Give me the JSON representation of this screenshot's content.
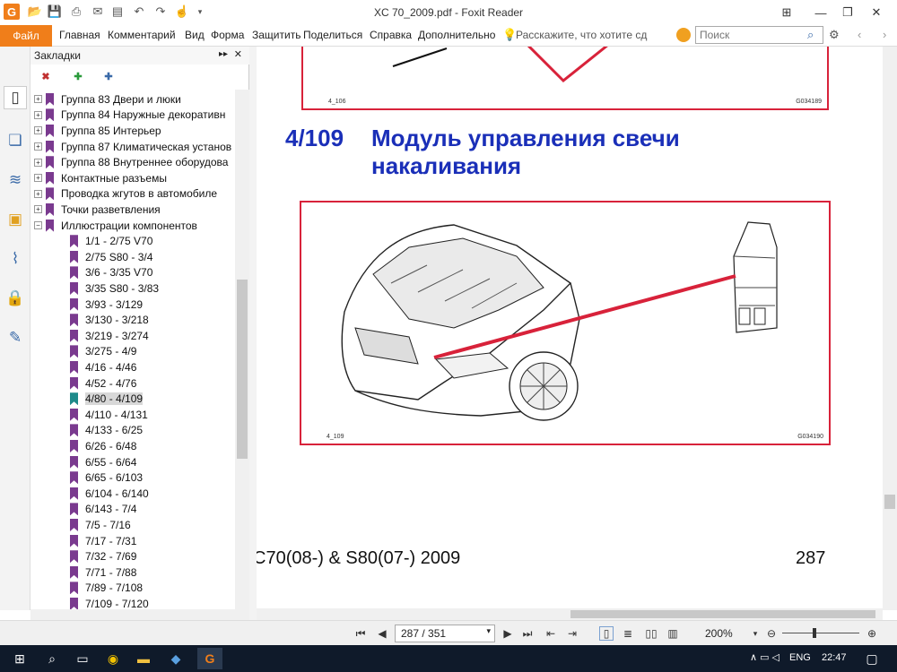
{
  "window": {
    "title": "XC 70_2009.pdf - Foxit Reader"
  },
  "menu": {
    "file": "Файл",
    "items": [
      "Главная",
      "Комментарий",
      "Вид",
      "Форма",
      "Защитить",
      "Поделиться",
      "Справка",
      "Дополнительно"
    ],
    "tell_me": "Расскажите, что хотите сд",
    "search_placeholder": "Поиск"
  },
  "bookmarks": {
    "header": "Закладки",
    "tree": [
      {
        "label": "Группа 83 Двери и люки",
        "toggle": "+",
        "level": 0
      },
      {
        "label": "Группа 84 Наружные декоративн",
        "toggle": "+",
        "level": 0
      },
      {
        "label": "Группа 85 Интерьер",
        "toggle": "+",
        "level": 0
      },
      {
        "label": "Группа 87 Климатическая установ",
        "toggle": "+",
        "level": 0
      },
      {
        "label": "Группа 88 Внутреннее оборудова",
        "toggle": "+",
        "level": 0
      },
      {
        "label": "Контактные разъемы",
        "toggle": "+",
        "level": 0
      },
      {
        "label": "Проводка жгутов в автомобиле",
        "toggle": "+",
        "level": 0
      },
      {
        "label": "Точки разветвления",
        "toggle": "+",
        "level": 0
      },
      {
        "label": "Иллюстрации компонентов",
        "toggle": "−",
        "level": 0
      },
      {
        "label": "1/1 - 2/75 V70",
        "level": 1
      },
      {
        "label": "2/75 S80 - 3/4",
        "level": 1
      },
      {
        "label": "3/6 - 3/35 V70",
        "level": 1
      },
      {
        "label": "3/35 S80 - 3/83",
        "level": 1
      },
      {
        "label": "3/93 - 3/129",
        "level": 1
      },
      {
        "label": "3/130 - 3/218",
        "level": 1
      },
      {
        "label": "3/219 - 3/274",
        "level": 1
      },
      {
        "label": "3/275 - 4/9",
        "level": 1
      },
      {
        "label": "4/16 - 4/46",
        "level": 1
      },
      {
        "label": "4/52 - 4/76",
        "level": 1
      },
      {
        "label": "4/80 - 4/109",
        "level": 1,
        "selected": true
      },
      {
        "label": "4/110 - 4/131",
        "level": 1
      },
      {
        "label": "4/133 - 6/25",
        "level": 1
      },
      {
        "label": "6/26 - 6/48",
        "level": 1
      },
      {
        "label": "6/55 - 6/64",
        "level": 1
      },
      {
        "label": "6/65 - 6/103",
        "level": 1
      },
      {
        "label": "6/104 - 6/140",
        "level": 1
      },
      {
        "label": "6/143 - 7/4",
        "level": 1
      },
      {
        "label": "7/5 - 7/16",
        "level": 1
      },
      {
        "label": "7/17 - 7/31",
        "level": 1
      },
      {
        "label": "7/32 - 7/69",
        "level": 1
      },
      {
        "label": "7/71 - 7/88",
        "level": 1
      },
      {
        "label": "7/89 - 7/108",
        "level": 1
      },
      {
        "label": "7/109 - 7/120",
        "level": 1
      }
    ]
  },
  "document": {
    "fig_top_left": "4_106",
    "fig_top_right": "G034189",
    "section_number": "4/109",
    "section_title": "Модуль управления свечи накаливания",
    "fig_left": "4_109",
    "fig_right": "G034190",
    "footer_model": "C70(08-) & S80(07-) 2009",
    "footer_page": "287"
  },
  "status": {
    "page": "287 / 351",
    "zoom": "200%"
  },
  "taskbar": {
    "lang": "ENG",
    "time": "22:47"
  },
  "colors": {
    "accent": "#f07e1a",
    "heading": "#1a2fb8",
    "figure_border": "#d8223a",
    "bookmark": "#7a3a8f",
    "bookmark_selected": "#1e8a8a"
  }
}
